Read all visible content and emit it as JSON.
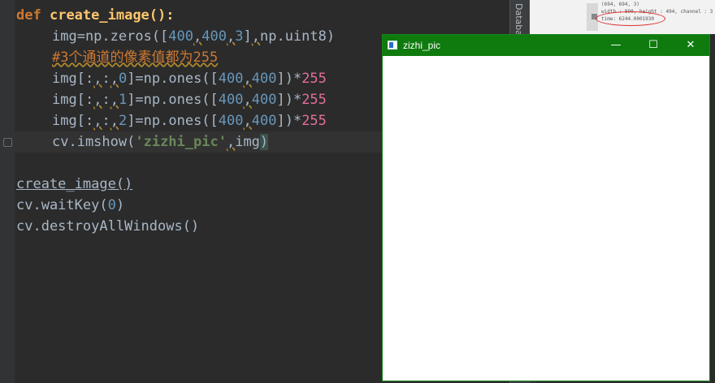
{
  "editor": {
    "lines": {
      "l1": {
        "def": "def",
        "name": "create_image",
        "paren": "():"
      },
      "l2": {
        "a": "img=np.zeros([",
        "n1": "400",
        "c1": ",",
        "n2": "400",
        "c2": ",",
        "n3": "3",
        "b": "]",
        "c3": ",",
        "d": "np.uint8)"
      },
      "l3": {
        "comment": "#3个通道的像素值都为255"
      },
      "l4": {
        "a": "img[:",
        "c1": ",",
        "b": ":",
        "c2": ",",
        "n1": "0",
        "d": "]=np.ones([",
        "n2": "400",
        "c3": ",",
        "n3": "400",
        "e": "])*",
        "n4": "255"
      },
      "l5": {
        "a": "img[:",
        "c1": ",",
        "b": ":",
        "c2": ",",
        "n1": "1",
        "d": "]=np.ones([",
        "n2": "400",
        "c3": ",",
        "n3": "400",
        "e": "])*",
        "n4": "255"
      },
      "l6": {
        "a": "img[:",
        "c1": ",",
        "b": ":",
        "c2": ",",
        "n1": "2",
        "d": "]=np.ones([",
        "n2": "400",
        "c3": ",",
        "n3": "400",
        "e": "])*",
        "n4": "255"
      },
      "l7": {
        "a": "cv.imshow(",
        "s": "'zizhi_pic'",
        "c": ",",
        "b": "img",
        "p": ")"
      },
      "l8": {
        "a": "create_image()"
      },
      "l9": {
        "a": "cv.waitKey(",
        "n": "0",
        "p": ")"
      },
      "l10": {
        "a": "cv.destroyAllWindows()"
      }
    }
  },
  "side_tab": {
    "label": "Database"
  },
  "background_screenshot": {
    "line1": "(694, 694, 3)",
    "line2": "width : 890, height : 494, channel : 3",
    "line3": "time: 6244.0001930"
  },
  "window": {
    "title": "zizhi_pic",
    "minimize": "—",
    "maximize": "☐",
    "close": "✕"
  },
  "colors": {
    "titlebar": "#0f7b0f",
    "editor_bg": "#2b2b2b",
    "keyword": "#cc7832",
    "number": "#6897bb"
  }
}
